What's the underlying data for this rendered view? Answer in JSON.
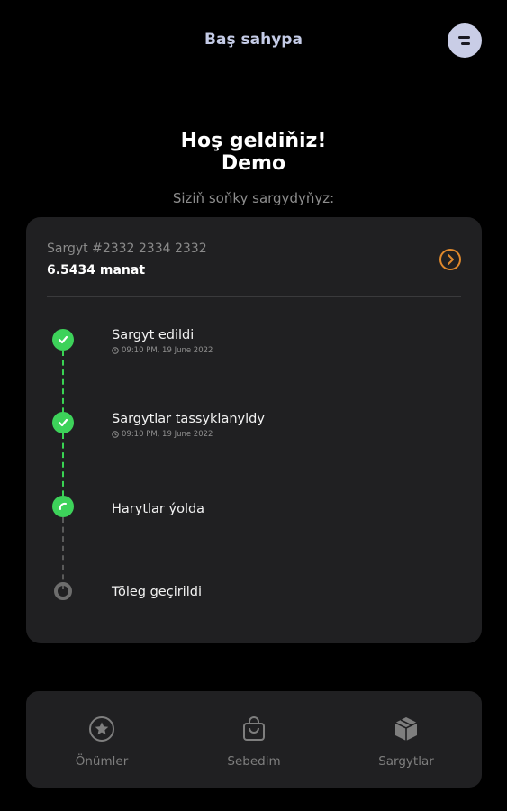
{
  "header": {
    "title": "Baş sahypa",
    "menu_icon": "menu-icon"
  },
  "welcome": {
    "line1": "Hoş geldiňiz!",
    "line2": "Demo"
  },
  "subtitle": "Siziň soňky sargydyňyz:",
  "order": {
    "number": "Sargyt #2332 2334 2332",
    "amount": "6.5434 manat",
    "open_icon": "chevron-right-circle-icon",
    "steps": [
      {
        "title": "Sargyt edildi",
        "time": "09:10 PM, 19 June 2022",
        "status": "done"
      },
      {
        "title": "Sargytlar tassyklanyldy",
        "time": "09:10 PM, 19 June 2022",
        "status": "done"
      },
      {
        "title": "Harytlar ýolda",
        "time": "",
        "status": "in-progress"
      },
      {
        "title": "Töleg geçirildi",
        "time": "",
        "status": "pending"
      }
    ]
  },
  "nav": [
    {
      "label": "Önümler",
      "icon": "star-icon"
    },
    {
      "label": "Sebedim",
      "icon": "shopping-bag-icon"
    },
    {
      "label": "Sargytlar",
      "icon": "package-icon"
    }
  ],
  "colors": {
    "accent": "#e0892c",
    "success": "#3dd25a",
    "header": "#c4cbe6",
    "card": "#202022"
  }
}
